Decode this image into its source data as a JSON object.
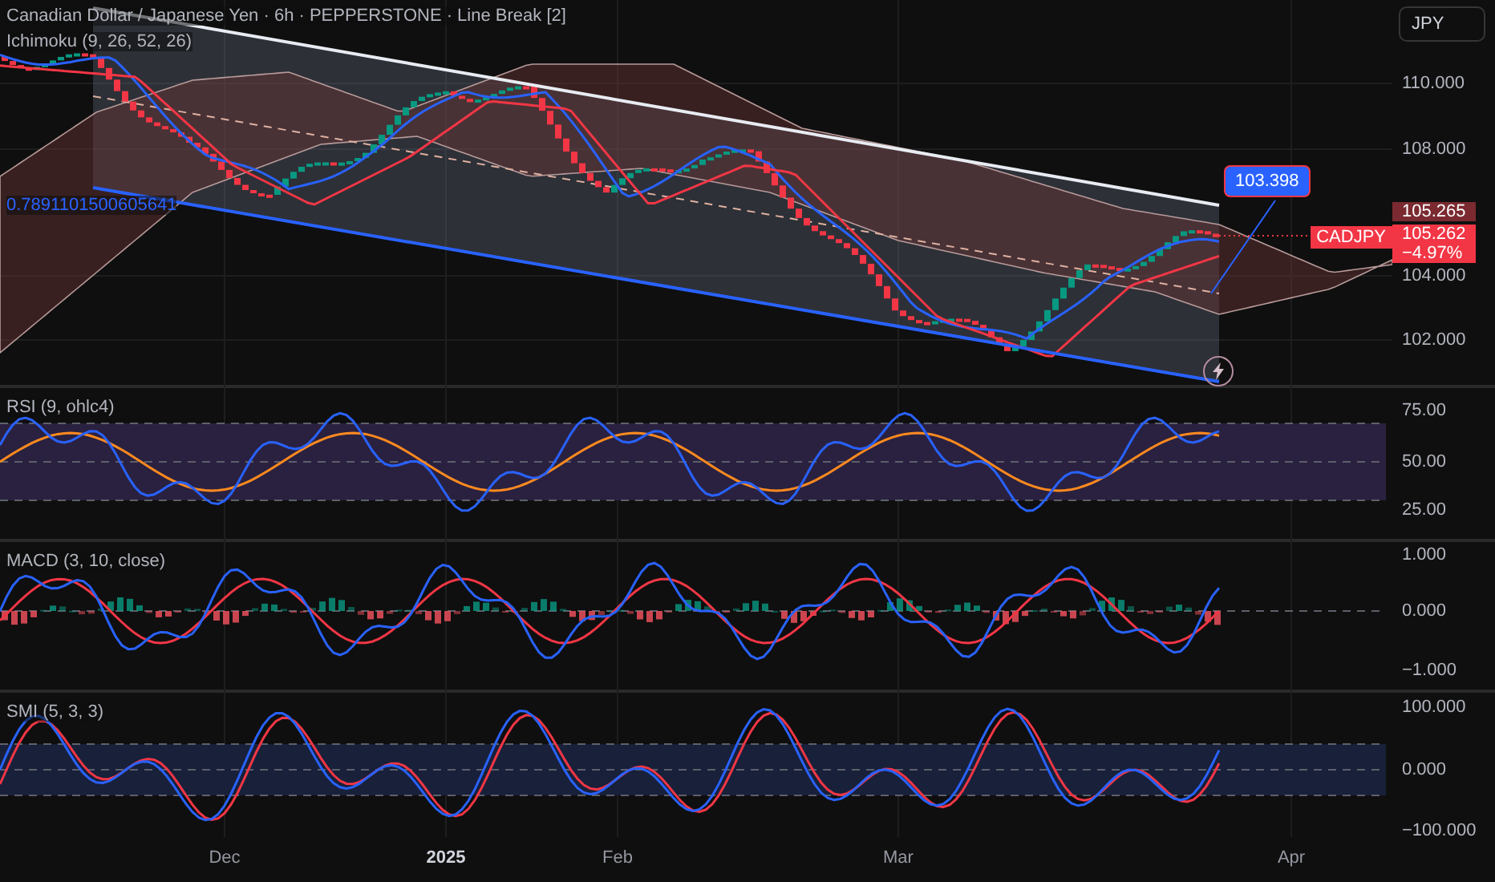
{
  "header": {
    "title": "Canadian Dollar / Japanese Yen · 6h · PEPPERSTONE · Line Break [2]",
    "indicator": "Ichimoku (9, 26, 52, 26)",
    "channel_label": "0.7891101500605641"
  },
  "currency_button": "JPY",
  "price_axis": [
    "110.000",
    "108.000",
    "104.000",
    "102.000"
  ],
  "callout": "103.398",
  "price_tags": [
    {
      "kind": "high",
      "price": "105.265"
    },
    {
      "kind": "last",
      "symbol": "CADJPY",
      "price": "105.262",
      "change": "−4.97%"
    }
  ],
  "panes": [
    {
      "kind": "rsi",
      "title": "RSI (9, ohlc4)",
      "ticks": [
        "75.00",
        "50.00",
        "25.00"
      ]
    },
    {
      "kind": "macd",
      "title": "MACD (3, 10, close)",
      "ticks": [
        "1.000",
        "0.000",
        "−1.000"
      ]
    },
    {
      "kind": "smi",
      "title": "SMI (5, 3, 3)",
      "ticks": [
        "100.000",
        "0.000",
        "−100.000"
      ]
    }
  ],
  "time_axis": [
    {
      "label": "Dec",
      "bold": false
    },
    {
      "label": "2025",
      "bold": true
    },
    {
      "label": "Feb",
      "bold": false
    },
    {
      "label": "Mar",
      "bold": false
    },
    {
      "label": "Apr",
      "bold": false
    }
  ]
}
